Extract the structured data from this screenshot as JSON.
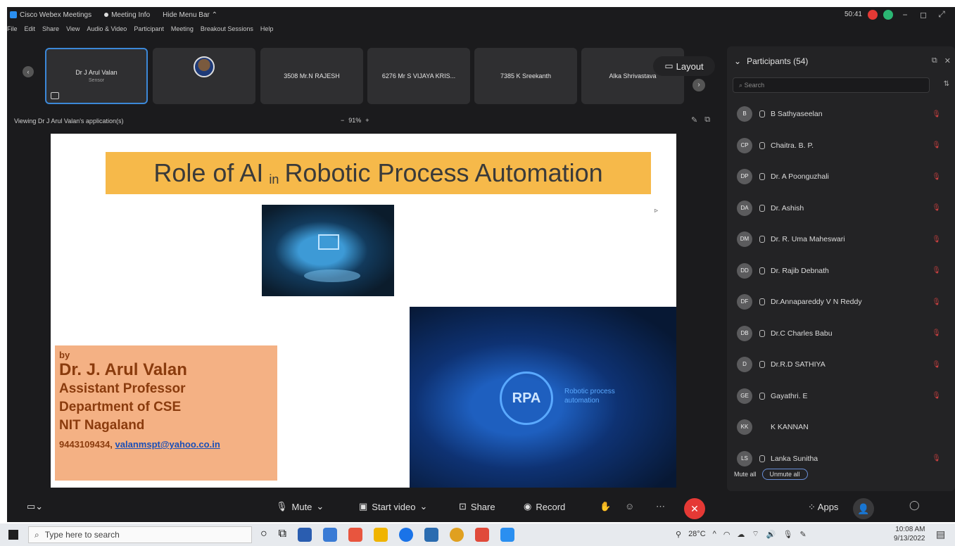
{
  "titlebar": {
    "app_name": "Cisco Webex Meetings",
    "meeting_info": "Meeting Info",
    "hide_menu": "Hide Menu Bar",
    "time": "50:41"
  },
  "menu": [
    "File",
    "Edit",
    "Share",
    "View",
    "Audio & Video",
    "Participant",
    "Meeting",
    "Breakout Sessions",
    "Help"
  ],
  "strip": {
    "tiles": [
      {
        "name": "Dr J Arul Valan",
        "sub": "Sensor"
      },
      {
        "name": "",
        "sub": ""
      },
      {
        "name": "3508 Mr.N RAJESH",
        "sub": ""
      },
      {
        "name": "6276 Mr S VIJAYA KRIS...",
        "sub": ""
      },
      {
        "name": "7385 K Sreekanth",
        "sub": ""
      },
      {
        "name": "Alka Shrivastava",
        "sub": ""
      }
    ],
    "layout_label": "Layout"
  },
  "viewing_text": "Viewing Dr J Arul Valan's application(s)",
  "zoom": {
    "minus": "−",
    "value": "91%",
    "plus": "+"
  },
  "slide": {
    "title_part1": "Role of AI",
    "title_small": "in",
    "title_part2": "Robotic Process Automation",
    "rpa_label": "RPA",
    "rpa_text_1": "Robotic process",
    "rpa_text_2": "automation",
    "by": "by",
    "author_name": "Dr. J. Arul Valan",
    "author_title": "Assistant Professor",
    "author_dept": "Department of  CSE",
    "author_inst": "NIT Nagaland",
    "phone": "9443109434,",
    "email": "valanmspt@yahoo.co.in"
  },
  "panel": {
    "title": "Participants (54)",
    "search_placeholder": "Search",
    "participants": [
      {
        "initials": "B",
        "name": "B Sathyaseelan"
      },
      {
        "initials": "CP",
        "name": "Chaitra. B. P."
      },
      {
        "initials": "DP",
        "name": "Dr. A Poonguzhali"
      },
      {
        "initials": "DA",
        "name": "Dr. Ashish"
      },
      {
        "initials": "DM",
        "name": "Dr. R. Uma Maheswari"
      },
      {
        "initials": "DD",
        "name": "Dr. Rajib Debnath"
      },
      {
        "initials": "DF",
        "name": "Dr.Annapareddy V N Reddy"
      },
      {
        "initials": "DB",
        "name": "Dr.C Charles Babu"
      },
      {
        "initials": "D",
        "name": "Dr.R.D SATHIYA"
      },
      {
        "initials": "GE",
        "name": "Gayathri. E"
      },
      {
        "initials": "KK",
        "name": "K KANNAN"
      },
      {
        "initials": "LS",
        "name": "Lanka Sunitha"
      }
    ],
    "mute_all": "Mute all",
    "unmute_all": "Unmute all"
  },
  "controls": {
    "mute": "Mute",
    "start_video": "Start video",
    "share": "Share",
    "record": "Record",
    "apps": "Apps"
  },
  "taskbar": {
    "search_placeholder": "Type here to search",
    "temperature": "28°C",
    "time": "10:08 AM",
    "date": "9/13/2022"
  },
  "colors": {
    "title_band": "#f6b94a",
    "author_box": "#f4b184",
    "end_call": "#e53935",
    "active_tile": "#3c88d8"
  }
}
